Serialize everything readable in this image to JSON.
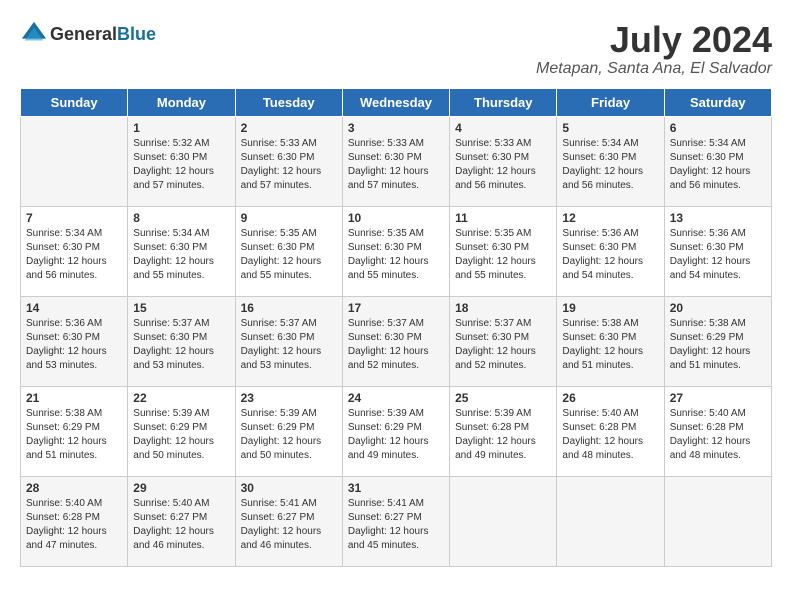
{
  "header": {
    "logo": {
      "general": "General",
      "blue": "Blue"
    },
    "title": "July 2024",
    "location": "Metapan, Santa Ana, El Salvador"
  },
  "days_of_week": [
    "Sunday",
    "Monday",
    "Tuesday",
    "Wednesday",
    "Thursday",
    "Friday",
    "Saturday"
  ],
  "weeks": [
    [
      {
        "day": "",
        "content": ""
      },
      {
        "day": "1",
        "content": "Sunrise: 5:32 AM\nSunset: 6:30 PM\nDaylight: 12 hours\nand 57 minutes."
      },
      {
        "day": "2",
        "content": "Sunrise: 5:33 AM\nSunset: 6:30 PM\nDaylight: 12 hours\nand 57 minutes."
      },
      {
        "day": "3",
        "content": "Sunrise: 5:33 AM\nSunset: 6:30 PM\nDaylight: 12 hours\nand 57 minutes."
      },
      {
        "day": "4",
        "content": "Sunrise: 5:33 AM\nSunset: 6:30 PM\nDaylight: 12 hours\nand 56 minutes."
      },
      {
        "day": "5",
        "content": "Sunrise: 5:34 AM\nSunset: 6:30 PM\nDaylight: 12 hours\nand 56 minutes."
      },
      {
        "day": "6",
        "content": "Sunrise: 5:34 AM\nSunset: 6:30 PM\nDaylight: 12 hours\nand 56 minutes."
      }
    ],
    [
      {
        "day": "7",
        "content": "Sunrise: 5:34 AM\nSunset: 6:30 PM\nDaylight: 12 hours\nand 56 minutes."
      },
      {
        "day": "8",
        "content": "Sunrise: 5:34 AM\nSunset: 6:30 PM\nDaylight: 12 hours\nand 55 minutes."
      },
      {
        "day": "9",
        "content": "Sunrise: 5:35 AM\nSunset: 6:30 PM\nDaylight: 12 hours\nand 55 minutes."
      },
      {
        "day": "10",
        "content": "Sunrise: 5:35 AM\nSunset: 6:30 PM\nDaylight: 12 hours\nand 55 minutes."
      },
      {
        "day": "11",
        "content": "Sunrise: 5:35 AM\nSunset: 6:30 PM\nDaylight: 12 hours\nand 55 minutes."
      },
      {
        "day": "12",
        "content": "Sunrise: 5:36 AM\nSunset: 6:30 PM\nDaylight: 12 hours\nand 54 minutes."
      },
      {
        "day": "13",
        "content": "Sunrise: 5:36 AM\nSunset: 6:30 PM\nDaylight: 12 hours\nand 54 minutes."
      }
    ],
    [
      {
        "day": "14",
        "content": "Sunrise: 5:36 AM\nSunset: 6:30 PM\nDaylight: 12 hours\nand 53 minutes."
      },
      {
        "day": "15",
        "content": "Sunrise: 5:37 AM\nSunset: 6:30 PM\nDaylight: 12 hours\nand 53 minutes."
      },
      {
        "day": "16",
        "content": "Sunrise: 5:37 AM\nSunset: 6:30 PM\nDaylight: 12 hours\nand 53 minutes."
      },
      {
        "day": "17",
        "content": "Sunrise: 5:37 AM\nSunset: 6:30 PM\nDaylight: 12 hours\nand 52 minutes."
      },
      {
        "day": "18",
        "content": "Sunrise: 5:37 AM\nSunset: 6:30 PM\nDaylight: 12 hours\nand 52 minutes."
      },
      {
        "day": "19",
        "content": "Sunrise: 5:38 AM\nSunset: 6:30 PM\nDaylight: 12 hours\nand 51 minutes."
      },
      {
        "day": "20",
        "content": "Sunrise: 5:38 AM\nSunset: 6:29 PM\nDaylight: 12 hours\nand 51 minutes."
      }
    ],
    [
      {
        "day": "21",
        "content": "Sunrise: 5:38 AM\nSunset: 6:29 PM\nDaylight: 12 hours\nand 51 minutes."
      },
      {
        "day": "22",
        "content": "Sunrise: 5:39 AM\nSunset: 6:29 PM\nDaylight: 12 hours\nand 50 minutes."
      },
      {
        "day": "23",
        "content": "Sunrise: 5:39 AM\nSunset: 6:29 PM\nDaylight: 12 hours\nand 50 minutes."
      },
      {
        "day": "24",
        "content": "Sunrise: 5:39 AM\nSunset: 6:29 PM\nDaylight: 12 hours\nand 49 minutes."
      },
      {
        "day": "25",
        "content": "Sunrise: 5:39 AM\nSunset: 6:28 PM\nDaylight: 12 hours\nand 49 minutes."
      },
      {
        "day": "26",
        "content": "Sunrise: 5:40 AM\nSunset: 6:28 PM\nDaylight: 12 hours\nand 48 minutes."
      },
      {
        "day": "27",
        "content": "Sunrise: 5:40 AM\nSunset: 6:28 PM\nDaylight: 12 hours\nand 48 minutes."
      }
    ],
    [
      {
        "day": "28",
        "content": "Sunrise: 5:40 AM\nSunset: 6:28 PM\nDaylight: 12 hours\nand 47 minutes."
      },
      {
        "day": "29",
        "content": "Sunrise: 5:40 AM\nSunset: 6:27 PM\nDaylight: 12 hours\nand 46 minutes."
      },
      {
        "day": "30",
        "content": "Sunrise: 5:41 AM\nSunset: 6:27 PM\nDaylight: 12 hours\nand 46 minutes."
      },
      {
        "day": "31",
        "content": "Sunrise: 5:41 AM\nSunset: 6:27 PM\nDaylight: 12 hours\nand 45 minutes."
      },
      {
        "day": "",
        "content": ""
      },
      {
        "day": "",
        "content": ""
      },
      {
        "day": "",
        "content": ""
      }
    ]
  ]
}
